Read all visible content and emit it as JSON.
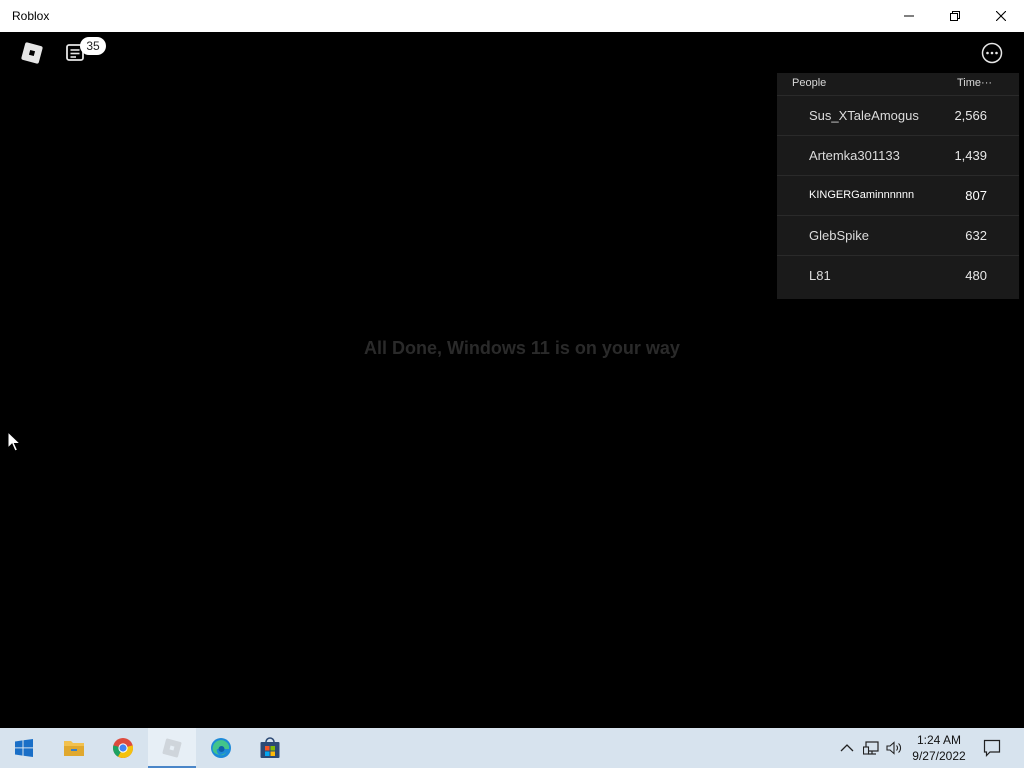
{
  "window": {
    "title": "Roblox",
    "controls": [
      "minimize",
      "restore",
      "close"
    ]
  },
  "game": {
    "chat_badge_count": "35",
    "center_message": "All Done, Windows 11 is on your way"
  },
  "leaderboard": {
    "col_people": "People",
    "col_time": "Time···",
    "rows": [
      {
        "name": "Sus_XTaleAmogus",
        "value": "2,566"
      },
      {
        "name": "Artemka301133",
        "value": "1,439"
      },
      {
        "name": "KINGERGaminnnnnn",
        "value": "807"
      },
      {
        "name": "GlebSpike",
        "value": "632"
      },
      {
        "name": "L81",
        "value": "480"
      }
    ]
  },
  "taskbar": {
    "apps": [
      "start-icon",
      "file-explorer-icon",
      "chrome-icon",
      "roblox-icon",
      "edge-icon",
      "store-icon"
    ],
    "time": "1:24 AM",
    "date": "9/27/2022"
  },
  "colors": {
    "titlebar_bg": "#ffffff",
    "game_bg": "#000000",
    "leaderboard_bg": "#1a1a1a",
    "taskbar_bg": "#d7e3ee",
    "taskbar_active_indicator": "#4a86c8"
  }
}
